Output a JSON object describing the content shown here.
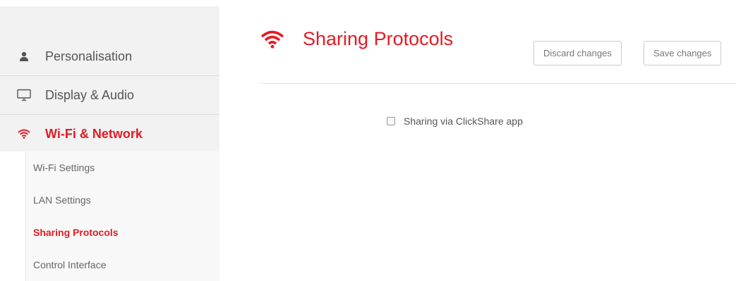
{
  "sidebar": {
    "main_items": [
      {
        "label": "Personalisation",
        "icon": "user-icon"
      },
      {
        "label": "Display & Audio",
        "icon": "monitor-icon"
      },
      {
        "label": "Wi-Fi & Network",
        "icon": "wifi-icon",
        "active": true
      }
    ],
    "sub_items": [
      {
        "label": "Wi-Fi Settings"
      },
      {
        "label": "LAN Settings"
      },
      {
        "label": "Sharing Protocols",
        "active": true
      },
      {
        "label": "Control Interface"
      }
    ]
  },
  "main": {
    "title": "Sharing Protocols",
    "title_icon": "wifi-icon",
    "discard_label": "Discard changes",
    "save_label": "Save changes",
    "option_label": "Sharing via ClickShare app",
    "option_checked": false
  },
  "colors": {
    "accent": "#e31b23",
    "text": "#555555",
    "sidebar_bg": "#f2f2f2"
  }
}
